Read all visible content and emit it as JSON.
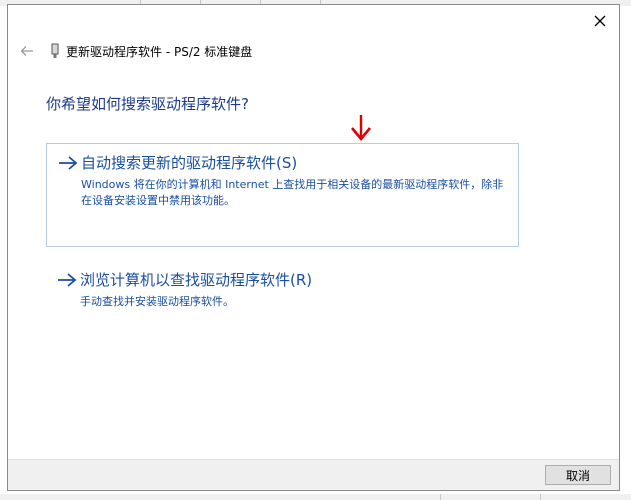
{
  "header": {
    "title": "更新驱动程序软件 - PS/2 标准键盘"
  },
  "main": {
    "question": "你希望如何搜索驱动程序软件?",
    "options": [
      {
        "title": "自动搜索更新的驱动程序软件(S)",
        "description": "Windows 将在你的计算机和 Internet 上查找用于相关设备的最新驱动程序软件，除非在设备安装设置中禁用该功能。"
      },
      {
        "title": "浏览计算机以查找驱动程序软件(R)",
        "description": "手动查找并安装驱动程序软件。"
      }
    ]
  },
  "footer": {
    "cancel_label": "取消"
  },
  "icons": {
    "close": "close-icon",
    "back": "back-arrow-icon",
    "device": "device-icon",
    "option_arrow": "right-arrow-icon",
    "annotation": "red-down-arrow-icon"
  },
  "colors": {
    "link_blue": "#1a4fa0",
    "heading_blue": "#1e3a8a",
    "annotation_red": "#e00000",
    "selected_border": "#b8cce4"
  }
}
